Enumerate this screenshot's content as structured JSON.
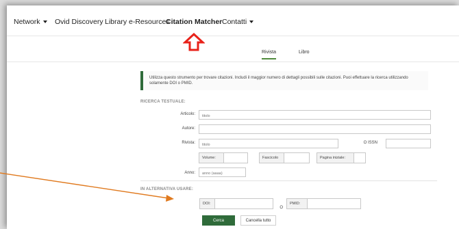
{
  "nav": {
    "items": [
      {
        "label": "Network",
        "dropdown": true
      },
      {
        "label": "Ovid Discovery",
        "dropdown": false
      },
      {
        "label": "Library e-Resources",
        "dropdown": false
      },
      {
        "label": "Citation Matcher",
        "dropdown": false,
        "active": true
      },
      {
        "label": "Contatti",
        "dropdown": true
      }
    ]
  },
  "subtabs": [
    "Rivista",
    "Libro"
  ],
  "active_subtab": "Rivista",
  "info_text": "Utilizza questo strumento per trovare citazioni. Includi il maggior numero di dettagli possibili sulle citazioni. Puoi effettuare la ricerca utilizzando solamente DOI o PMID.",
  "text_search": {
    "heading": "RICERCA TESTUALE:",
    "article_label": "Articolo:",
    "article_placeholder": "titolo",
    "author_label": "Autore:",
    "journal_label": "Rivista:",
    "journal_placeholder": "titolo",
    "issn_label": "O ISSN",
    "volume_label": "Volume:",
    "issue_label": "Fascicolo",
    "start_page_label": "Pagina iniziale:",
    "year_label": "Anno:",
    "year_placeholder": "anno (aaaa)"
  },
  "alternative": {
    "heading": "IN ALTERNATIVA USARE:",
    "doi_label": "DOI:",
    "or_label": "O",
    "pmid_label": "PMID:"
  },
  "buttons": {
    "search": "Cerca",
    "clear": "Cancella tutto"
  },
  "colors": {
    "accent_green": "#2f6b3a",
    "annotation_red": "#e8221a",
    "annotation_orange": "#e07a1f"
  }
}
